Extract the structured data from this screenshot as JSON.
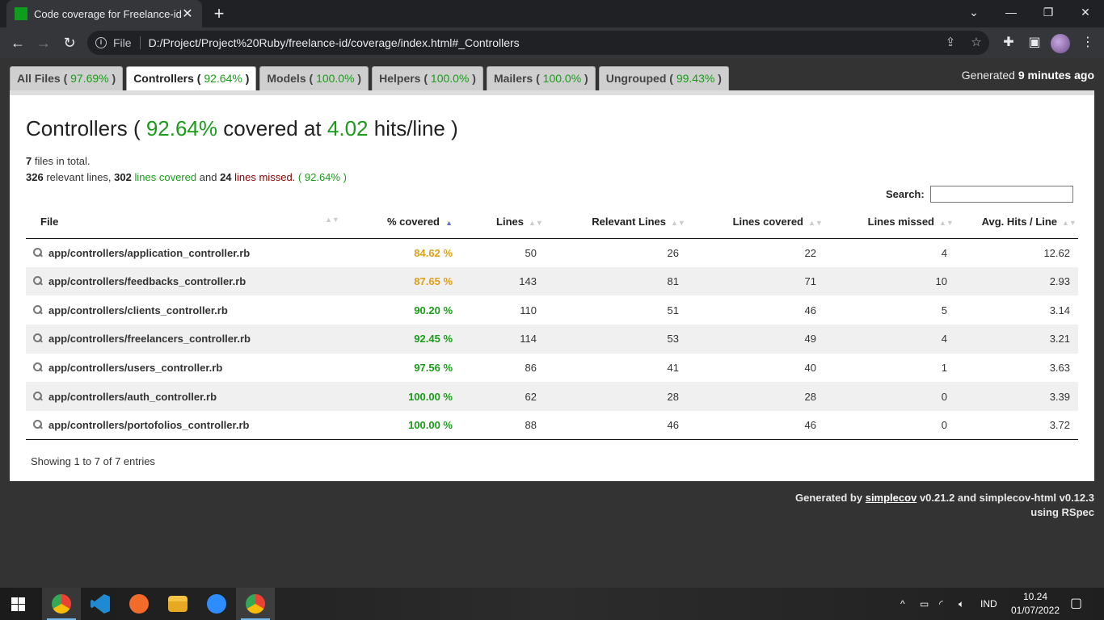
{
  "browser": {
    "tab_title": "Code coverage for Freelance-id",
    "omnibox_file_label": "File",
    "url": "D:/Project/Project%20Ruby/freelance-id/coverage/index.html#_Controllers"
  },
  "coverage_tabs": [
    {
      "label": "All Files",
      "pct": "97.69%"
    },
    {
      "label": "Controllers",
      "pct": "92.64%"
    },
    {
      "label": "Models",
      "pct": "100.0%"
    },
    {
      "label": "Helpers",
      "pct": "100.0%"
    },
    {
      "label": "Mailers",
      "pct": "100.0%"
    },
    {
      "label": "Ungrouped",
      "pct": "99.43%"
    }
  ],
  "generated": {
    "prefix": "Generated",
    "when": "9 minutes ago"
  },
  "panel": {
    "title_name": "Controllers",
    "title_pct": "92.64%",
    "title_mid": "covered at",
    "title_hits": "4.02",
    "title_suffix": "hits/line",
    "files_count": "7",
    "files_text": "files in total.",
    "relevant_count": "326",
    "relevant_text": "relevant lines,",
    "covered_count": "302",
    "covered_text": "lines covered",
    "and_text": "and",
    "missed_count": "24",
    "missed_text": "lines missed.",
    "summary_pct": "92.64%"
  },
  "search": {
    "label": "Search:",
    "value": ""
  },
  "table": {
    "headers": [
      "File",
      "% covered",
      "Lines",
      "Relevant Lines",
      "Lines covered",
      "Lines missed",
      "Avg. Hits / Line"
    ],
    "rows": [
      {
        "file": "app/controllers/application_controller.rb",
        "covered": "84.62 %",
        "lines": "50",
        "relevant": "26",
        "lines_covered": "22",
        "missed": "4",
        "avg": "12.62"
      },
      {
        "file": "app/controllers/feedbacks_controller.rb",
        "covered": "87.65 %",
        "lines": "143",
        "relevant": "81",
        "lines_covered": "71",
        "missed": "10",
        "avg": "2.93"
      },
      {
        "file": "app/controllers/clients_controller.rb",
        "covered": "90.20 %",
        "lines": "110",
        "relevant": "51",
        "lines_covered": "46",
        "missed": "5",
        "avg": "3.14"
      },
      {
        "file": "app/controllers/freelancers_controller.rb",
        "covered": "92.45 %",
        "lines": "114",
        "relevant": "53",
        "lines_covered": "49",
        "missed": "4",
        "avg": "3.21"
      },
      {
        "file": "app/controllers/users_controller.rb",
        "covered": "97.56 %",
        "lines": "86",
        "relevant": "41",
        "lines_covered": "40",
        "missed": "1",
        "avg": "3.63"
      },
      {
        "file": "app/controllers/auth_controller.rb",
        "covered": "100.00 %",
        "lines": "62",
        "relevant": "28",
        "lines_covered": "28",
        "missed": "0",
        "avg": "3.39"
      },
      {
        "file": "app/controllers/portofolios_controller.rb",
        "covered": "100.00 %",
        "lines": "88",
        "relevant": "46",
        "lines_covered": "46",
        "missed": "0",
        "avg": "3.72"
      }
    ],
    "showing": "Showing 1 to 7 of 7 entries"
  },
  "footer": {
    "line1_prefix": "Generated by",
    "link": "simplecov",
    "line1_suffix": "v0.21.2 and simplecov-html v0.12.3",
    "line2": "using RSpec"
  },
  "taskbar": {
    "lang": "IND",
    "time": "10.24",
    "date": "01/07/2022"
  },
  "colors": {
    "green": "#1a9c1a",
    "yellow": "#dca01a",
    "red": "#8b0000"
  }
}
